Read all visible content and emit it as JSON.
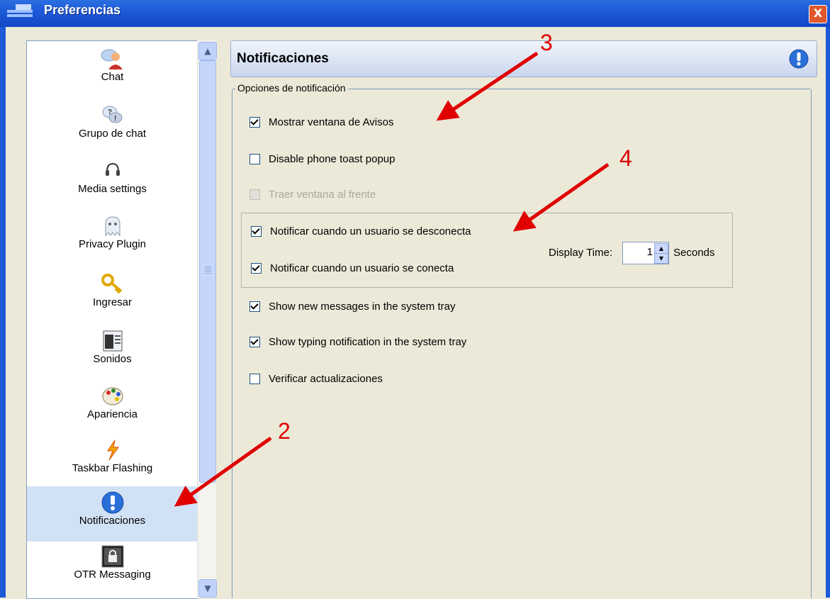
{
  "window": {
    "title": "Preferencias",
    "close_label": "X"
  },
  "sidebar": {
    "items": [
      {
        "label": "Chat",
        "icon": "chat-user-icon"
      },
      {
        "label": "Grupo de chat",
        "icon": "group-chat-icon"
      },
      {
        "label": "Media settings",
        "icon": "headset-icon"
      },
      {
        "label": "Privacy Plugin",
        "icon": "ghost-icon"
      },
      {
        "label": "Ingresar",
        "icon": "key-icon"
      },
      {
        "label": "Sonidos",
        "icon": "sounds-icon"
      },
      {
        "label": "Apariencia",
        "icon": "palette-icon"
      },
      {
        "label": "Taskbar Flashing",
        "icon": "lightning-icon"
      },
      {
        "label": "Notificaciones",
        "icon": "exclamation-icon",
        "selected": true
      },
      {
        "label": "OTR Messaging",
        "icon": "otr-lock-icon"
      }
    ]
  },
  "panel": {
    "title": "Notificaciones",
    "group_legend": "Opciones de notificación",
    "options": [
      {
        "label": "Mostrar ventana de Avisos",
        "checked": true,
        "enabled": true
      },
      {
        "label": "Disable phone toast popup",
        "checked": false,
        "enabled": true
      },
      {
        "label": "Traer ventana al frente",
        "checked": false,
        "enabled": false
      },
      {
        "label": "Notificar cuando un usuario se desconecta",
        "checked": true,
        "enabled": true
      },
      {
        "label": "Notificar cuando un usuario se conecta",
        "checked": true,
        "enabled": true
      },
      {
        "label": "Show new messages in the system tray",
        "checked": true,
        "enabled": true
      },
      {
        "label": "Show typing notification in the system tray",
        "checked": true,
        "enabled": true
      },
      {
        "label": "Verificar actualizaciones",
        "checked": false,
        "enabled": true
      }
    ],
    "display_time": {
      "label": "Display Time:",
      "value": "1",
      "unit": "Seconds"
    }
  },
  "annotations": [
    "3",
    "4",
    "2"
  ],
  "colors": {
    "accent": "#1d5ad8",
    "annotation": "#e00000",
    "selected": "#d2e2f6"
  }
}
